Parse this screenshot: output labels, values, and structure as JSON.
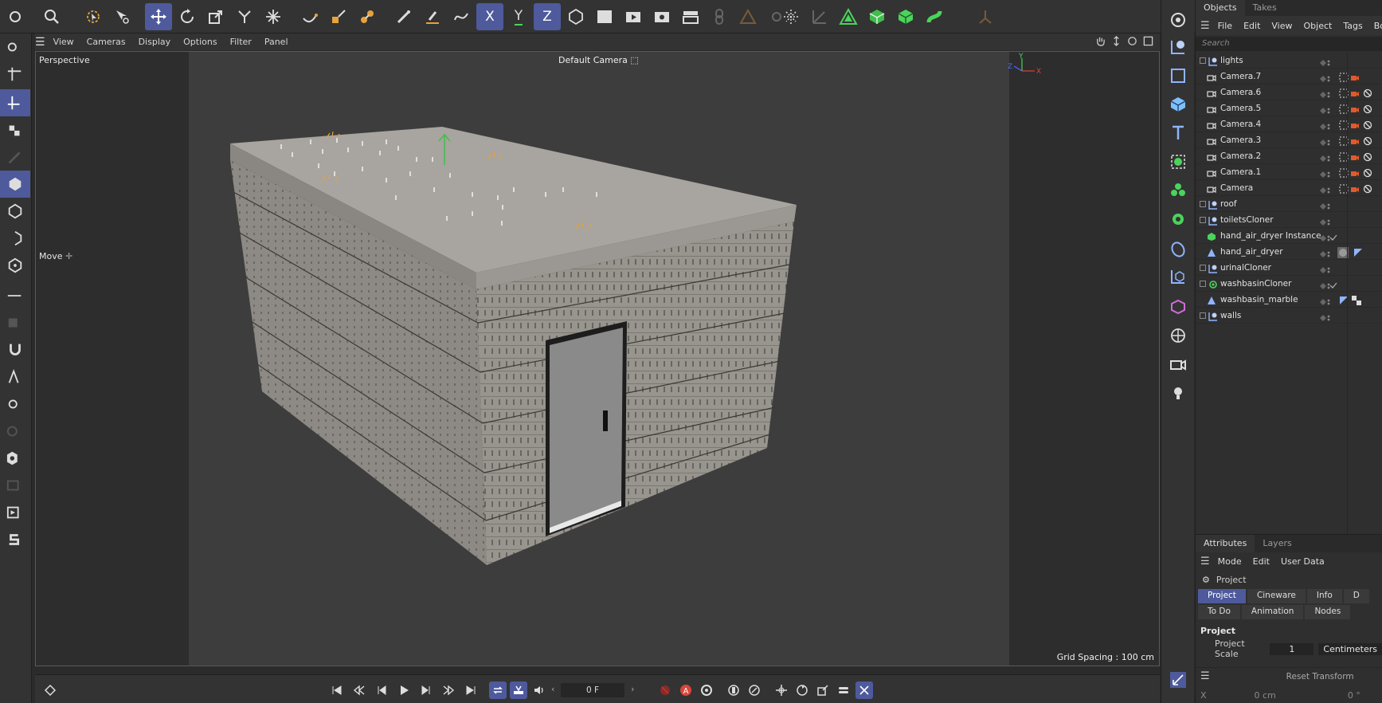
{
  "top_toolbar": {
    "icons": [
      "search-icon",
      "live-selection-icon",
      "select-tool-icon",
      "move-icon",
      "rotate-icon",
      "scale-icon",
      "transfer-icon",
      "soft-select-icon",
      "spline-pen-icon",
      "spline-sketch-icon",
      "paint-icon",
      "brush-icon",
      "spline-smooth-icon",
      "spline-arc-icon",
      "x-axis-icon",
      "y-axis-icon",
      "z-axis-icon",
      "coordinate-system-icon",
      "clapboard-icon",
      "render-view-icon",
      "render-settings-icon",
      "picture-viewer-icon",
      "chain-icon",
      "polygon-pen-icon",
      "gear-icon",
      "snap-icon",
      "workplane-icon",
      "triangle-icon",
      "cube-green-icon",
      "cube-teal-icon",
      "spline-green-icon",
      "quantize-icon"
    ],
    "axis_x": "X",
    "axis_y": "Y",
    "axis_z": "Z"
  },
  "viewport_menu": {
    "items": [
      "View",
      "Cameras",
      "Display",
      "Options",
      "Filter",
      "Panel"
    ]
  },
  "viewport": {
    "label": "Perspective",
    "camera": "Default Camera",
    "tool_label": "Move",
    "grid_spacing": "Grid Spacing : 100 cm"
  },
  "objects_panel": {
    "tabs": [
      "Objects",
      "Takes"
    ],
    "menu": [
      "File",
      "Edit",
      "View",
      "Object",
      "Tags",
      "Book"
    ],
    "search_placeholder": "Search",
    "rows": [
      {
        "name": "lights",
        "type": "null",
        "expander": true,
        "indent": 0
      },
      {
        "name": "Camera.7",
        "type": "camera",
        "expander": false,
        "indent": 1
      },
      {
        "name": "Camera.6",
        "type": "camera",
        "expander": false,
        "indent": 1
      },
      {
        "name": "Camera.5",
        "type": "camera",
        "expander": false,
        "indent": 1
      },
      {
        "name": "Camera.4",
        "type": "camera",
        "expander": false,
        "indent": 1
      },
      {
        "name": "Camera.3",
        "type": "camera",
        "expander": false,
        "indent": 1
      },
      {
        "name": "Camera.2",
        "type": "camera",
        "expander": false,
        "indent": 1
      },
      {
        "name": "Camera.1",
        "type": "camera",
        "expander": false,
        "indent": 1
      },
      {
        "name": "Camera",
        "type": "camera",
        "expander": false,
        "indent": 1
      },
      {
        "name": "roof",
        "type": "null",
        "expander": true,
        "indent": 0
      },
      {
        "name": "toiletsCloner",
        "type": "null",
        "expander": true,
        "indent": 0
      },
      {
        "name": "hand_air_dryer Instance",
        "type": "instance",
        "expander": false,
        "indent": 1
      },
      {
        "name": "hand_air_dryer",
        "type": "mesh",
        "expander": false,
        "indent": 1
      },
      {
        "name": "urinalCloner",
        "type": "null",
        "expander": true,
        "indent": 0
      },
      {
        "name": "washbasinCloner",
        "type": "cloner",
        "expander": true,
        "indent": 0
      },
      {
        "name": "washbasin_marble",
        "type": "mesh",
        "expander": false,
        "indent": 1
      },
      {
        "name": "walls",
        "type": "null",
        "expander": true,
        "indent": 0
      }
    ]
  },
  "attributes_panel": {
    "tabs": [
      "Attributes",
      "Layers"
    ],
    "menu": [
      "Mode",
      "Edit",
      "User Data"
    ],
    "title": "Project",
    "subtabs": [
      "Project",
      "Cineware",
      "Info",
      "D"
    ],
    "subtabs2": [
      "To Do",
      "Animation",
      "Nodes"
    ],
    "section": "Project",
    "scale_label": "Project Scale",
    "scale_value": "1",
    "scale_unit": "Centimeters",
    "reset_label": "Reset Transform",
    "coord_axis": "X",
    "coord_value": "0 cm",
    "coord_angle": "0 °"
  },
  "timeline": {
    "frame": "0 F"
  },
  "colors": {
    "accent": "#4e5a9c",
    "camera_icon": "#e05a2b",
    "null_icon": "#bcd2ff",
    "green": "#34c759"
  }
}
